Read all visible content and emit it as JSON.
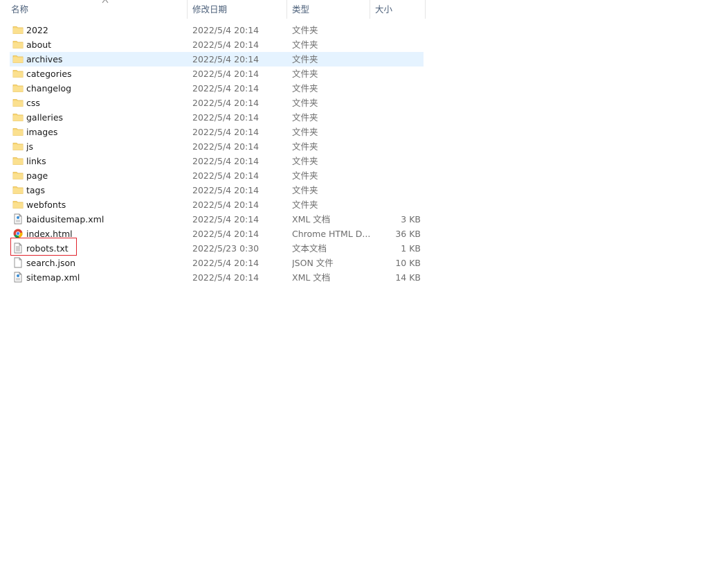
{
  "columns": {
    "name": "名称",
    "date": "修改日期",
    "type": "类型",
    "size": "大小"
  },
  "files": [
    {
      "name": "2022",
      "date": "2022/5/4 20:14",
      "type": "文件夹",
      "size": "",
      "icon": "folder-icon"
    },
    {
      "name": "about",
      "date": "2022/5/4 20:14",
      "type": "文件夹",
      "size": "",
      "icon": "folder-icon"
    },
    {
      "name": "archives",
      "date": "2022/5/4 20:14",
      "type": "文件夹",
      "size": "",
      "icon": "folder-icon",
      "selected": true
    },
    {
      "name": "categories",
      "date": "2022/5/4 20:14",
      "type": "文件夹",
      "size": "",
      "icon": "folder-icon"
    },
    {
      "name": "changelog",
      "date": "2022/5/4 20:14",
      "type": "文件夹",
      "size": "",
      "icon": "folder-icon"
    },
    {
      "name": "css",
      "date": "2022/5/4 20:14",
      "type": "文件夹",
      "size": "",
      "icon": "folder-icon"
    },
    {
      "name": "galleries",
      "date": "2022/5/4 20:14",
      "type": "文件夹",
      "size": "",
      "icon": "folder-icon"
    },
    {
      "name": "images",
      "date": "2022/5/4 20:14",
      "type": "文件夹",
      "size": "",
      "icon": "folder-icon"
    },
    {
      "name": "js",
      "date": "2022/5/4 20:14",
      "type": "文件夹",
      "size": "",
      "icon": "folder-icon"
    },
    {
      "name": "links",
      "date": "2022/5/4 20:14",
      "type": "文件夹",
      "size": "",
      "icon": "folder-icon"
    },
    {
      "name": "page",
      "date": "2022/5/4 20:14",
      "type": "文件夹",
      "size": "",
      "icon": "folder-icon"
    },
    {
      "name": "tags",
      "date": "2022/5/4 20:14",
      "type": "文件夹",
      "size": "",
      "icon": "folder-icon"
    },
    {
      "name": "webfonts",
      "date": "2022/5/4 20:14",
      "type": "文件夹",
      "size": "",
      "icon": "folder-icon"
    },
    {
      "name": "baidusitemap.xml",
      "date": "2022/5/4 20:14",
      "type": "XML 文档",
      "size": "3 KB",
      "icon": "xml-file-icon"
    },
    {
      "name": "index.html",
      "date": "2022/5/4 20:14",
      "type": "Chrome HTML D...",
      "size": "36 KB",
      "icon": "chrome-html-icon"
    },
    {
      "name": "robots.txt",
      "date": "2022/5/23 0:30",
      "type": "文本文档",
      "size": "1 KB",
      "icon": "text-file-icon",
      "highlighted": true
    },
    {
      "name": "search.json",
      "date": "2022/5/4 20:14",
      "type": "JSON 文件",
      "size": "10 KB",
      "icon": "blank-file-icon"
    },
    {
      "name": "sitemap.xml",
      "date": "2022/5/4 20:14",
      "type": "XML 文档",
      "size": "14 KB",
      "icon": "xml-file-icon"
    }
  ],
  "colors": {
    "selected_row": "#e5f3ff",
    "highlight_box": "#e0232c",
    "folder": "#f8d775",
    "header_text": "#4c607a"
  }
}
